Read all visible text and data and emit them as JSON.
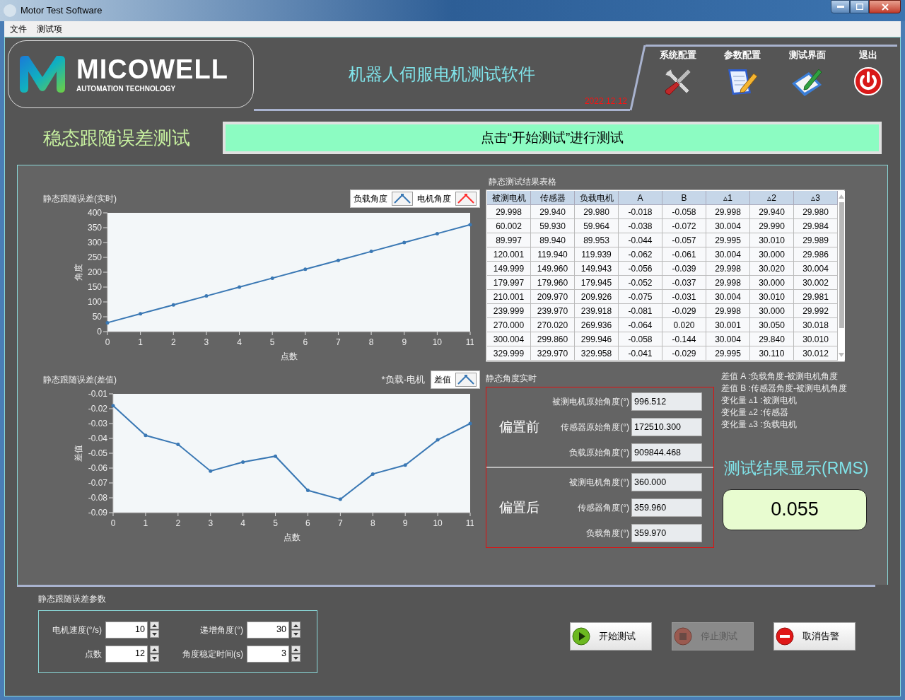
{
  "window": {
    "title": "Motor Test Software"
  },
  "menu": [
    "文件",
    "测试项"
  ],
  "header": {
    "logo": {
      "name": "MICOWELL",
      "tagline": "AUTOMATION TECHNOLOGY"
    },
    "title": "机器人伺服电机测试软件",
    "date": "2022.12.12",
    "nav": [
      {
        "label": "系统配置",
        "kind": "tools"
      },
      {
        "label": "参数配置",
        "kind": "notepad"
      },
      {
        "label": "测试界面",
        "kind": "tablet"
      },
      {
        "label": "退出",
        "kind": "power"
      }
    ]
  },
  "test_title": "稳态跟随误差测试",
  "status_message": "点击“开始测试”进行测试",
  "charts": [
    {
      "chart_data": {
        "type": "line",
        "legend": "upper right",
        "title": "静态跟随误差(实时)",
        "xlabel": "点数",
        "ylabel": "角度",
        "x": [
          0,
          1,
          2,
          3,
          4,
          5,
          6,
          7,
          8,
          9,
          10,
          11
        ],
        "xlim": [
          0,
          11
        ],
        "ylim": [
          0,
          400
        ],
        "xticks": [
          0,
          1,
          2,
          3,
          4,
          5,
          6,
          7,
          8,
          9,
          10,
          11
        ],
        "yticks": [
          0,
          50,
          100,
          150,
          200,
          250,
          300,
          350,
          400
        ],
        "series": [
          {
            "name": "负载角度",
            "color": "#3a78b4",
            "values": [
              30,
              60,
              90,
              120,
              150,
              180,
              210,
              240,
              270,
              300,
              330,
              360
            ]
          },
          {
            "name": "电机角度",
            "color": "#ff3030",
            "values": [
              null,
              null,
              null,
              null,
              null,
              null,
              null,
              null,
              null,
              null,
              null,
              null
            ]
          }
        ]
      }
    },
    {
      "legend_note": "*负载-电机",
      "chart_data": {
        "type": "line",
        "legend": "upper right",
        "title": "静态跟随误差(差值)",
        "xlabel": "点数",
        "ylabel": "差值",
        "x": [
          0,
          1,
          2,
          3,
          4,
          5,
          6,
          7,
          8,
          9,
          10,
          11
        ],
        "xlim": [
          0,
          11
        ],
        "ylim": [
          -0.09,
          -0.01
        ],
        "xticks": [
          0,
          1,
          2,
          3,
          4,
          5,
          6,
          7,
          8,
          9,
          10,
          11
        ],
        "yticks": [
          -0.09,
          -0.08,
          -0.07,
          -0.06,
          -0.05,
          -0.04,
          -0.03,
          -0.02,
          -0.01
        ],
        "series": [
          {
            "name": "差值",
            "color": "#3a78b4",
            "values": [
              -0.018,
              -0.038,
              -0.044,
              -0.062,
              -0.056,
              -0.052,
              -0.075,
              -0.081,
              -0.064,
              -0.058,
              -0.041,
              -0.03
            ]
          }
        ]
      }
    }
  ],
  "results_table": {
    "title": "静态测试结果表格",
    "columns": [
      "被测电机",
      "传感器",
      "负载电机",
      "A",
      "B",
      "▵1",
      "▵2",
      "▵3"
    ],
    "rows": [
      [
        "29.998",
        "29.940",
        "29.980",
        "-0.018",
        "-0.058",
        "29.998",
        "29.940",
        "29.980"
      ],
      [
        "60.002",
        "59.930",
        "59.964",
        "-0.038",
        "-0.072",
        "30.004",
        "29.990",
        "29.984"
      ],
      [
        "89.997",
        "89.940",
        "89.953",
        "-0.044",
        "-0.057",
        "29.995",
        "30.010",
        "29.989"
      ],
      [
        "120.001",
        "119.940",
        "119.939",
        "-0.062",
        "-0.061",
        "30.004",
        "30.000",
        "29.986"
      ],
      [
        "149.999",
        "149.960",
        "149.943",
        "-0.056",
        "-0.039",
        "29.998",
        "30.020",
        "30.004"
      ],
      [
        "179.997",
        "179.960",
        "179.945",
        "-0.052",
        "-0.037",
        "29.998",
        "30.000",
        "30.002"
      ],
      [
        "210.001",
        "209.970",
        "209.926",
        "-0.075",
        "-0.031",
        "30.004",
        "30.010",
        "29.981"
      ],
      [
        "239.999",
        "239.970",
        "239.918",
        "-0.081",
        "-0.029",
        "29.998",
        "30.000",
        "29.992"
      ],
      [
        "270.000",
        "270.020",
        "269.936",
        "-0.064",
        "0.020",
        "30.001",
        "30.050",
        "30.018"
      ],
      [
        "300.004",
        "299.860",
        "299.946",
        "-0.058",
        "-0.144",
        "30.004",
        "29.840",
        "30.010"
      ],
      [
        "329.999",
        "329.970",
        "329.958",
        "-0.041",
        "-0.029",
        "29.995",
        "30.110",
        "30.012"
      ]
    ]
  },
  "instant_angles": {
    "title": "静态角度实时",
    "groups": [
      {
        "label": "偏置前",
        "fields": [
          {
            "label": "被测电机原始角度(°)",
            "value": "996.512"
          },
          {
            "label": "传感器原始角度(°)",
            "value": "172510.300"
          },
          {
            "label": "负载原始角度(°)",
            "value": "909844.468"
          }
        ]
      },
      {
        "label": "偏置后",
        "fields": [
          {
            "label": "被测电机角度(°)",
            "value": "360.000"
          },
          {
            "label": "传感器角度(°)",
            "value": "359.960"
          },
          {
            "label": "负载角度(°)",
            "value": "359.970"
          }
        ]
      }
    ]
  },
  "notes": [
    "差值 A :负载角度-被测电机角度",
    "差值 B :传感器角度-被测电机角度",
    "变化量 ▵1 :被测电机",
    "变化量 ▵2 :传感器",
    "变化量 ▵3 :负载电机"
  ],
  "rms": {
    "title": "测试结果显示(RMS)",
    "value": "0.055"
  },
  "parameters": {
    "title": "静态跟随误差参数",
    "fields": [
      {
        "label": "电机速度(°/s)",
        "value": "10"
      },
      {
        "label": "递增角度(°)",
        "value": "30"
      },
      {
        "label": "点数",
        "value": "12"
      },
      {
        "label": "角度稳定时间(s)",
        "value": "3"
      }
    ]
  },
  "buttons": [
    {
      "label": "开始测试",
      "kind": "start",
      "disabled": false
    },
    {
      "label": "停止测试",
      "kind": "stop",
      "disabled": true
    },
    {
      "label": "取消告警",
      "kind": "clear",
      "disabled": false
    }
  ]
}
